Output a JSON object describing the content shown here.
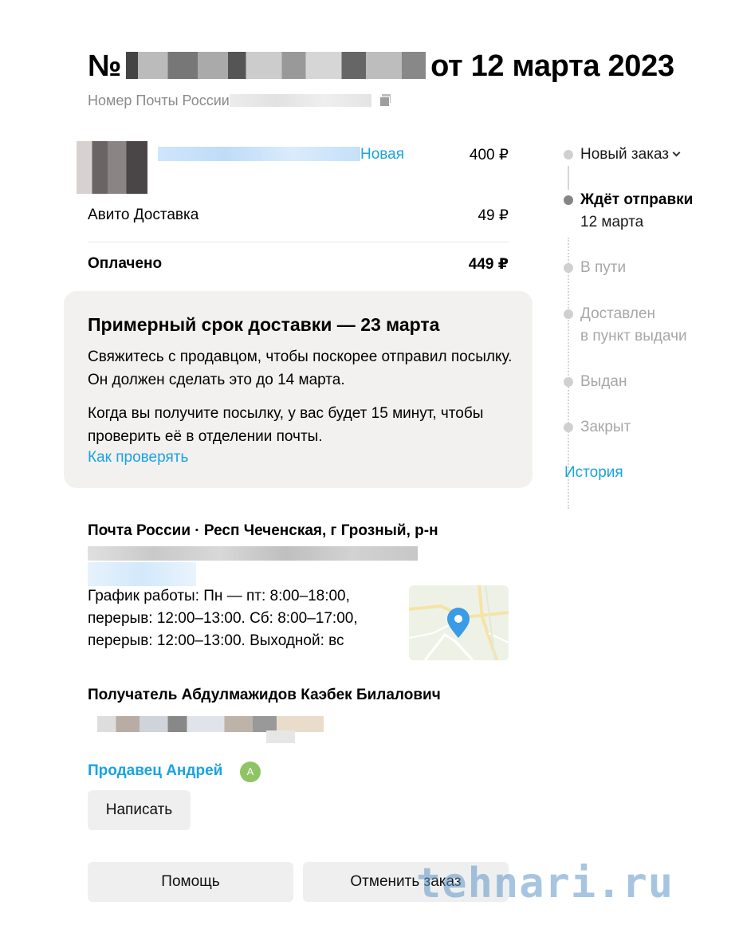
{
  "order": {
    "title_prefix": "№",
    "title_suffix": "от 12 марта 2023",
    "tracking_label": "Номер Почты России"
  },
  "item": {
    "status_label": "Новая",
    "price": "400 ₽"
  },
  "delivery": {
    "label": "Авито Доставка",
    "price": "49 ₽"
  },
  "total": {
    "label": "Оплачено",
    "value": "449 ₽"
  },
  "info": {
    "title": "Примерный срок доставки — 23 марта",
    "text1": "Свяжитесь с продавцом, чтобы поскорее отправил посылку. Он должен сделать это до 14 марта.",
    "text2": "Когда вы получите посылку, у вас будет 15 минут, чтобы проверить её в отделении почты.",
    "link": "Как проверять"
  },
  "timeline": {
    "steps": [
      {
        "label": "Новый заказ"
      },
      {
        "label": "Ждёт отправки",
        "sub": "12 марта"
      },
      {
        "label": "В пути"
      },
      {
        "label": "Доставлен",
        "sub": "в пункт выдачи"
      },
      {
        "label": "Выдан"
      },
      {
        "label": "Закрыт"
      }
    ],
    "history_link": "История"
  },
  "pickup": {
    "title": "Почта России · Респ Чеченская, г Грозный, р-н",
    "schedule": "График работы: Пн — пт: 8:00–18:00, перерыв: 12:00–13:00. Сб: 8:00–17:00, перерыв: 12:00–13:00. Выходной: вс"
  },
  "recipient": {
    "label": "Получатель Абдулмажидов Каэбек Билалович"
  },
  "seller": {
    "label": "Продавец Андрей",
    "avatar_letter": "А"
  },
  "buttons": {
    "write": "Написать",
    "help": "Помощь",
    "cancel": "Отменить заказ"
  },
  "watermark": "tehnari.ru",
  "colors": {
    "link": "#1aa3e0",
    "card_bg": "#f2f1f0",
    "button_bg": "#efefef",
    "avatar": "#8ec464"
  }
}
